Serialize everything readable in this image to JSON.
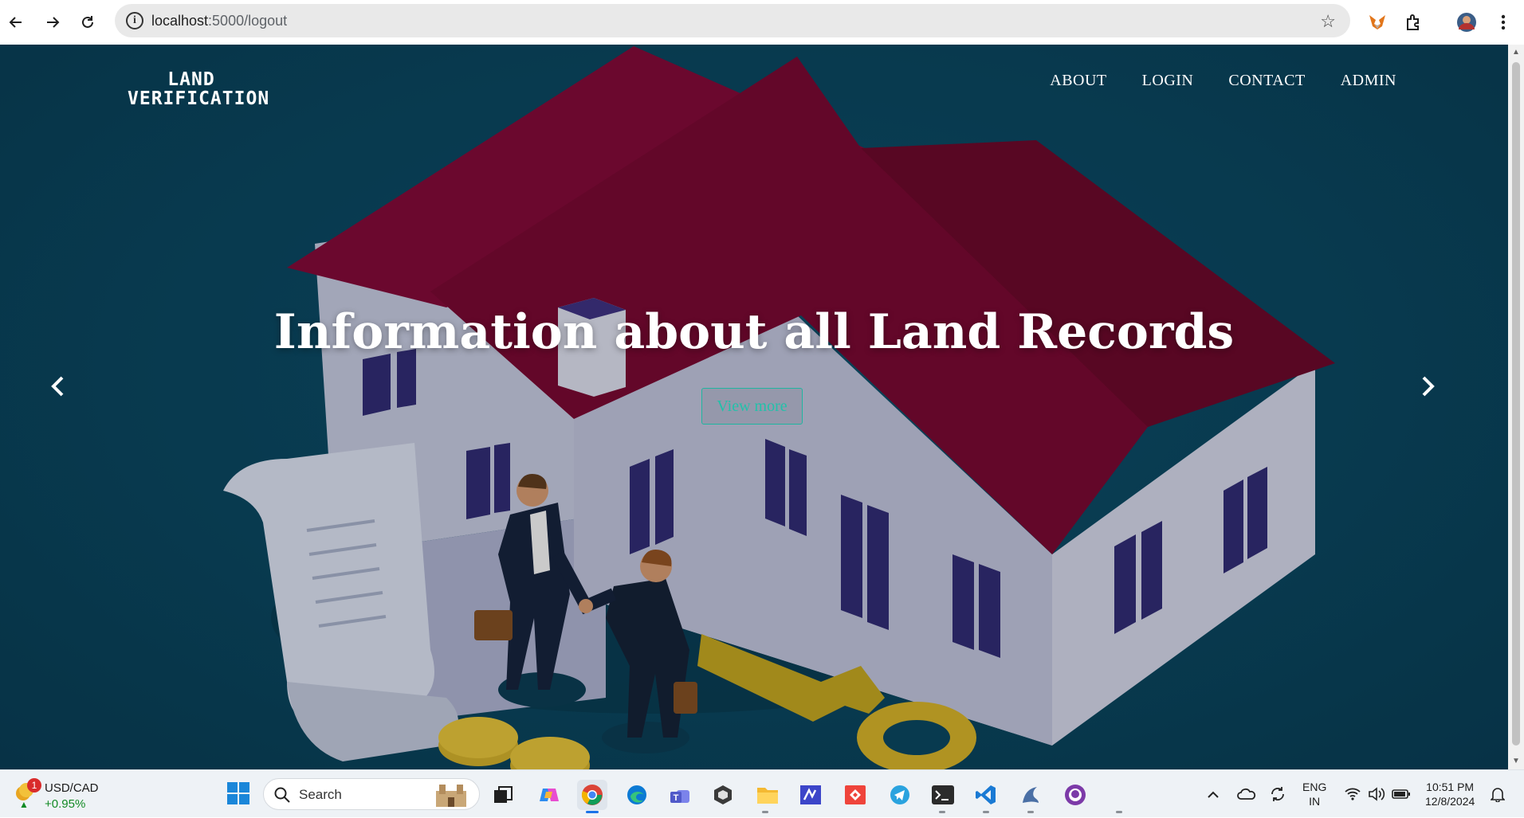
{
  "browser": {
    "url_host": "localhost",
    "url_path": ":5000/logout"
  },
  "site": {
    "logo_line1": "LAND",
    "logo_line2": "VERIFICATION",
    "nav": [
      {
        "label": "ABOUT"
      },
      {
        "label": "LOGIN"
      },
      {
        "label": "CONTACT"
      },
      {
        "label": "ADMIN"
      }
    ],
    "hero_title": "Information about all Land Records",
    "hero_button": "View more"
  },
  "taskbar": {
    "widget_title": "USD/CAD",
    "widget_change": "+0.95%",
    "widget_badge": "1",
    "search_label": "Search",
    "lang_line1": "ENG",
    "lang_line2": "IN",
    "time": "10:51 PM",
    "date": "12/8/2024"
  },
  "colors": {
    "page_bg": "#0a425a",
    "roof": "#7a0a35",
    "accent_button": "#22c1aa"
  }
}
